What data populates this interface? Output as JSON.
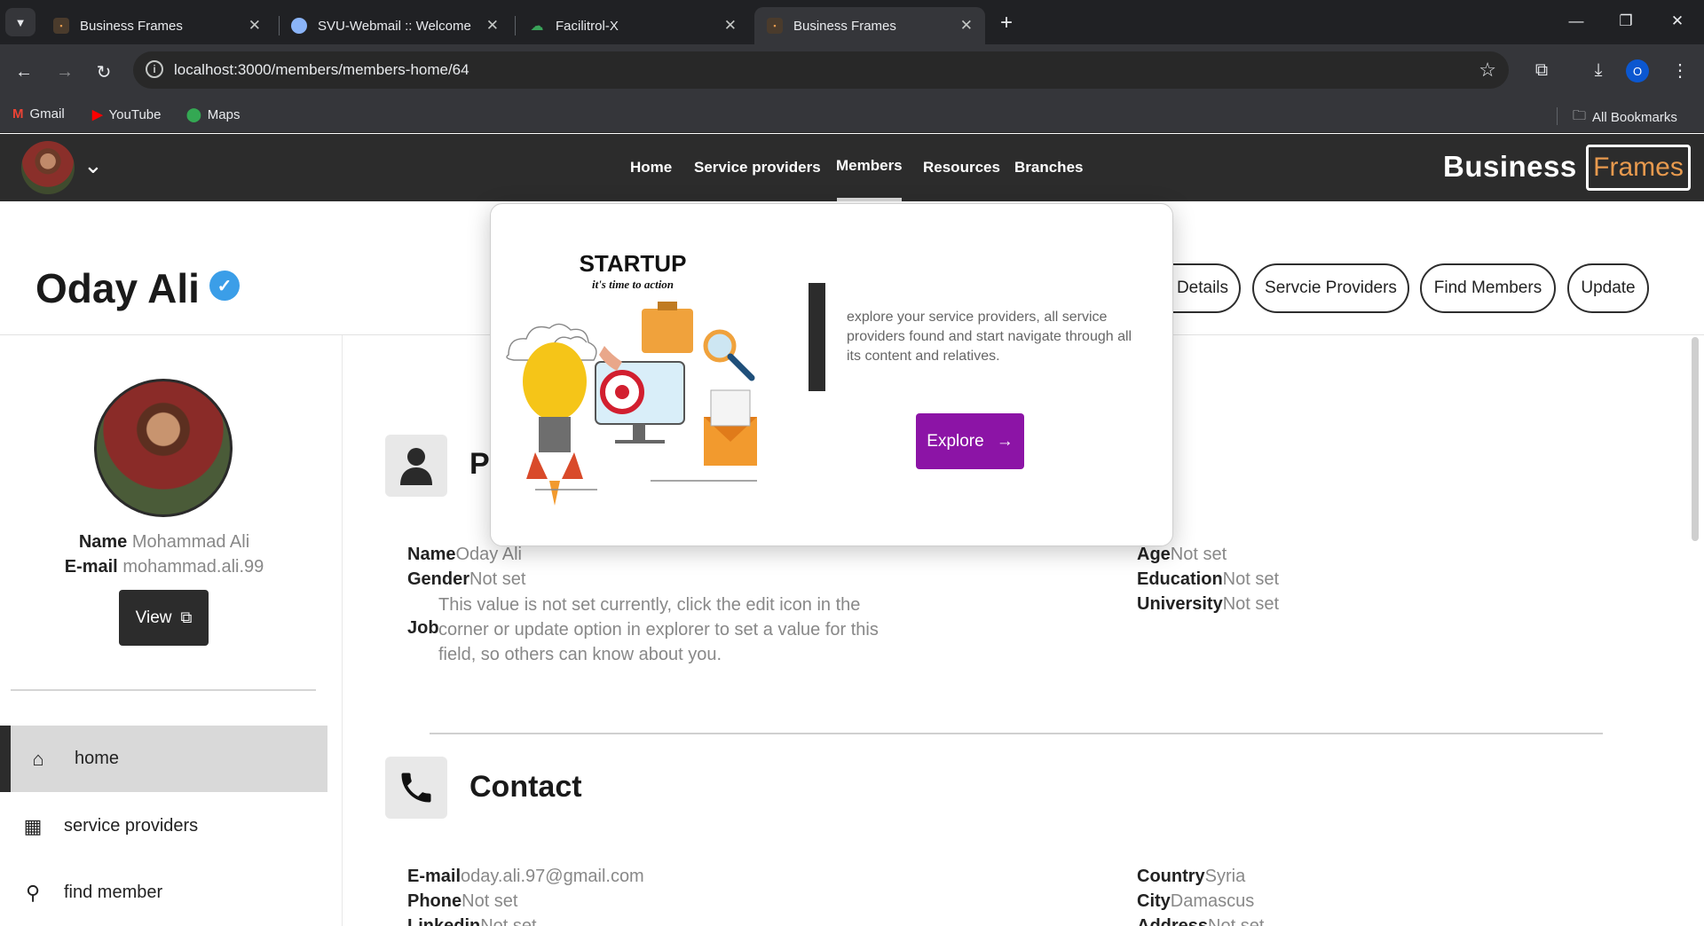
{
  "browser": {
    "tabs": [
      {
        "title": "Business Frames",
        "active": false
      },
      {
        "title": "SVU-Webmail :: Welcome",
        "active": false
      },
      {
        "title": "Facilitrol-X",
        "active": false
      },
      {
        "title": "Business Frames",
        "active": true
      }
    ],
    "url": "localhost:3000/members/members-home/64",
    "profile_initial": "O",
    "bookmarks": [
      {
        "label": "Gmail",
        "icon": "gmail-icon"
      },
      {
        "label": "YouTube",
        "icon": "youtube-icon"
      },
      {
        "label": "Maps",
        "icon": "maps-icon"
      }
    ],
    "all_bookmarks": "All Bookmarks"
  },
  "header": {
    "nav": [
      "Home",
      "Service providers",
      "Members",
      "Resources",
      "Branches"
    ],
    "active_nav": "Members",
    "brand_left": "Business",
    "brand_right": "Frames",
    "brand_right_color": "#e89a4e"
  },
  "page": {
    "title": "Oday Ali",
    "actions": [
      "Details",
      "Servcie Providers",
      "Find Members",
      "Update"
    ]
  },
  "sidebar": {
    "name_label": "Name",
    "name_value": "Mohammad Ali",
    "email_label": "E-mail",
    "email_value": "mohammad.ali.99",
    "view_label": "View",
    "items": [
      {
        "label": "home",
        "icon": "home-icon",
        "active": true
      },
      {
        "label": "service providers",
        "icon": "building-icon",
        "active": false
      },
      {
        "label": "find member",
        "icon": "search-icon",
        "active": false
      }
    ]
  },
  "personal": {
    "title_partial": "Pe",
    "name_label": "Name",
    "name_value": "Oday Ali",
    "gender_label": "Gender",
    "gender_value": "Not set",
    "job_label": "Job",
    "job_value": "This value is not set currently, click the edit icon in the corner or update option in explorer to set a value for this field, so others can know about you.",
    "age_label": "Age",
    "age_value": "Not set",
    "education_label": "Education",
    "education_value": "Not set",
    "university_label": "University",
    "university_value": "Not set"
  },
  "contact": {
    "title": "Contact",
    "email_label": "E-mail",
    "email_value": "oday.ali.97@gmail.com",
    "phone_label": "Phone",
    "phone_value": "Not set",
    "linkedin_label": "Linkedin",
    "linkedin_value": "Not set",
    "country_label": "Country",
    "country_value": "Syria",
    "city_label": "City",
    "city_value": "Damascus",
    "address_label": "Address",
    "address_value": "Not set"
  },
  "popup": {
    "illustration_title": "STARTUP",
    "illustration_subtitle": "it's time to action",
    "description": "explore your service providers, all service providers found and start navigate through all its content and relatives.",
    "button_label": "Explore",
    "button_color": "#8c14a6"
  }
}
